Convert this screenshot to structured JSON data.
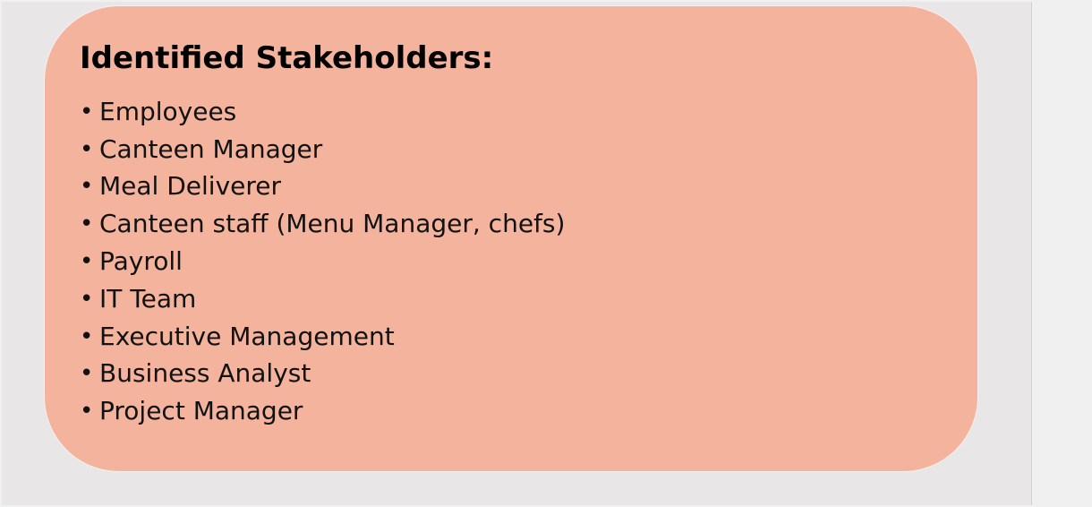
{
  "slide": {
    "title": "Identified Stakeholders:",
    "bullet_symbol": "•",
    "items": [
      {
        "label": "Employees"
      },
      {
        "label": "Canteen Manager"
      },
      {
        "label": "Meal Deliverer"
      },
      {
        "label": "Canteen staff (Menu Manager, chefs)"
      },
      {
        "label": "Payroll"
      },
      {
        "label": "IT Team"
      },
      {
        "label": "Executive Management"
      },
      {
        "label": "Business Analyst"
      },
      {
        "label": "Project Manager"
      }
    ]
  },
  "colors": {
    "card_fill": "#f4b39c",
    "canvas_background": "#e8e6e7",
    "text": "#000000"
  }
}
